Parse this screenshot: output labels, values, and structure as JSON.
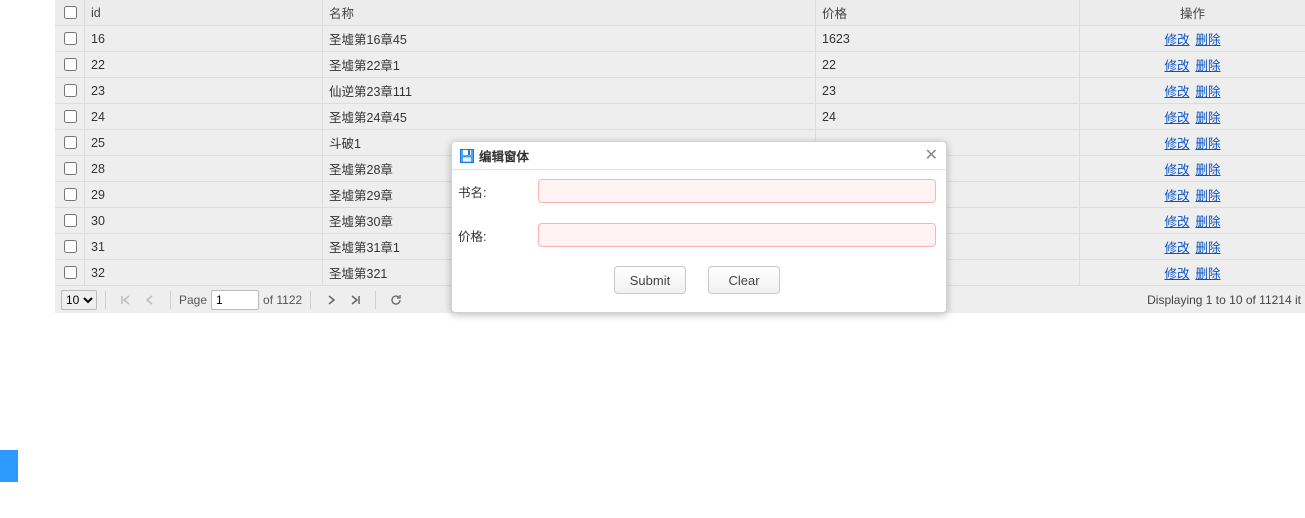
{
  "table": {
    "headers": {
      "id": "id",
      "name": "名称",
      "price": "价格",
      "ops": "操作"
    },
    "action_labels": {
      "edit": "修改",
      "delete": "删除"
    },
    "rows": [
      {
        "id": "16",
        "name": "圣墟第16章45",
        "price": "1623"
      },
      {
        "id": "22",
        "name": "圣墟第22章1",
        "price": "22"
      },
      {
        "id": "23",
        "name": "仙逆第23章111",
        "price": "23"
      },
      {
        "id": "24",
        "name": "圣墟第24章45",
        "price": "24"
      },
      {
        "id": "25",
        "name": "斗破1",
        "price": ""
      },
      {
        "id": "28",
        "name": "圣墟第28章",
        "price": ""
      },
      {
        "id": "29",
        "name": "圣墟第29章",
        "price": ""
      },
      {
        "id": "30",
        "name": "圣墟第30章",
        "price": ""
      },
      {
        "id": "31",
        "name": "圣墟第31章1",
        "price": ""
      },
      {
        "id": "32",
        "name": "圣墟第321",
        "price": ""
      }
    ]
  },
  "pager": {
    "page_size": "10",
    "page_label": "Page",
    "page_value": "1",
    "of_label": "of 1122",
    "display_text": "Displaying 1 to 10 of 11214 it"
  },
  "modal": {
    "title": "编辑窗体",
    "label_name": "书名:",
    "label_price": "价格:",
    "name_value": "",
    "price_value": "",
    "submit_label": "Submit",
    "clear_label": "Clear"
  }
}
